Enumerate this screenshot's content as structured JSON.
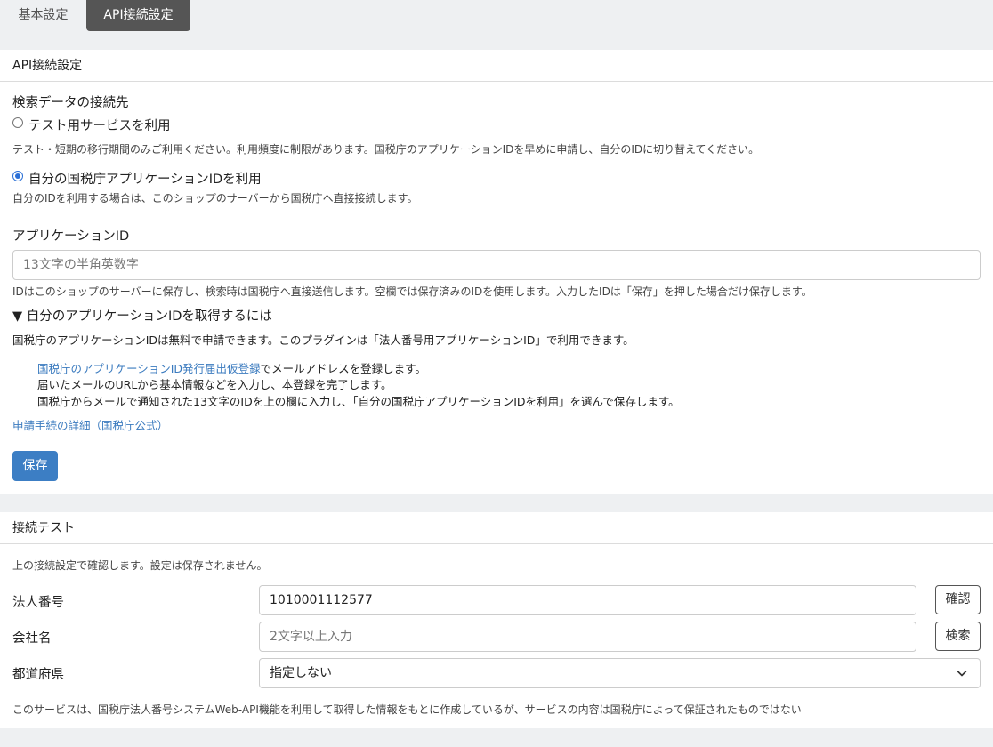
{
  "tabs": [
    {
      "label": "基本設定",
      "active": false
    },
    {
      "label": "API接続設定",
      "active": true
    }
  ],
  "api_settings": {
    "header": "API接続設定",
    "source_label": "検索データの接続先",
    "option_test": {
      "label": "テスト用サービスを利用",
      "note": "テスト・短期の移行期間のみご利用ください。利用頻度に制限があります。国税庁のアプリケーションIDを早めに申請し、自分のIDに切り替えてください。",
      "selected": false
    },
    "option_own": {
      "label": "自分の国税庁アプリケーションIDを利用",
      "note": "自分のIDを利用する場合は、このショップのサーバーから国税庁へ直接接続します。",
      "selected": true
    },
    "app_id_label": "アプリケーションID",
    "app_id_placeholder": "13文字の半角英数字",
    "app_id_note": "IDはこのショップのサーバーに保存し、検索時は国税庁へ直接送信します。空欄では保存済みのIDを使用します。入力したIDは「保存」を押した場合だけ保存します。",
    "howto": {
      "summary": "▼ 自分のアプリケーションIDを取得するには",
      "intro": "国税庁のアプリケーションIDは無料で申請できます。このプラグインは「法人番号用アプリケーションID」で利用できます。",
      "step1_link": "国税庁のアプリケーションID発行届出仮登録",
      "step1_rest": "でメールアドレスを登録します。",
      "step2": "届いたメールのURLから基本情報などを入力し、本登録を完了します。",
      "step3": "国税庁からメールで通知された13文字のIDを上の欄に入力し、「自分の国税庁アプリケーションIDを利用」を選んで保存します。",
      "details_link": "申請手続の詳細（国税庁公式）"
    },
    "save_label": "保存"
  },
  "connection_test": {
    "header": "接続テスト",
    "note": "上の接続設定で確認します。設定は保存されません。",
    "corp_number_label": "法人番号",
    "corp_number_value": "1010001112577",
    "confirm_label": "確認",
    "company_name_label": "会社名",
    "company_name_placeholder": "2文字以上入力",
    "search_label": "検索",
    "prefecture_label": "都道府県",
    "prefecture_selected": "指定しない",
    "disclaimer": "このサービスは、国税庁法人番号システムWeb-API機能を利用して取得した情報をもとに作成しているが、サービスの内容は国税庁によって保証されたものではない"
  },
  "colors": {
    "accent": "#3c7ec4",
    "active_tab": "#555555",
    "link": "#3b7bbf"
  }
}
